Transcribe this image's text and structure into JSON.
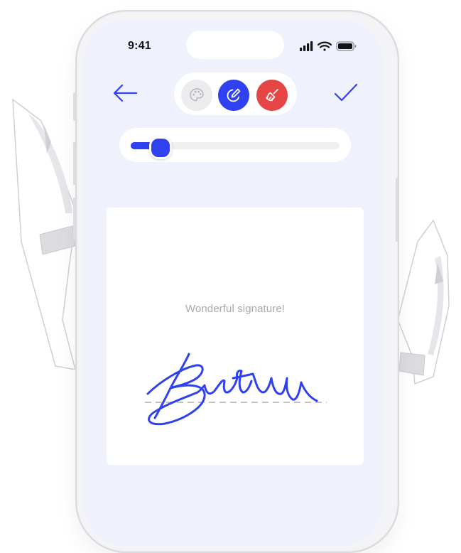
{
  "status_bar": {
    "time": "9:41",
    "icons": [
      "cellular-signal-icon",
      "wifi-icon",
      "battery-icon"
    ]
  },
  "toolbar": {
    "back_icon": "arrow-left-icon",
    "confirm_icon": "checkmark-icon",
    "tools": [
      {
        "name": "color-palette",
        "icon": "palette-icon",
        "color": "#ececef",
        "active": false
      },
      {
        "name": "pen",
        "icon": "pen-icon",
        "color": "#2f41f0",
        "active": true
      },
      {
        "name": "eraser",
        "icon": "broom-icon",
        "color": "#e64545",
        "active": false
      }
    ]
  },
  "stroke_slider": {
    "value_fraction": 0.1
  },
  "canvas": {
    "hint": "Wonderful signature!",
    "signature_color": "#2f41f0",
    "baseline_style": "dashed"
  },
  "colors": {
    "accent": "#2f41f0",
    "danger": "#e64545",
    "screen_background": "#eff1fc"
  }
}
